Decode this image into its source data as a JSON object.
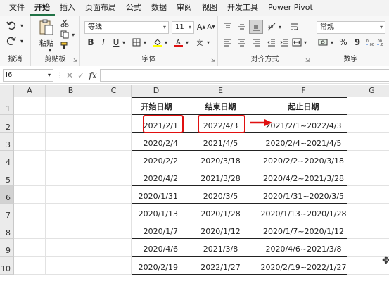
{
  "menu": {
    "items": [
      "文件",
      "开始",
      "插入",
      "页面布局",
      "公式",
      "数据",
      "审阅",
      "视图",
      "开发工具",
      "Power Pivot"
    ],
    "active_index": 1
  },
  "ribbon": {
    "undo_group_label": "撤消",
    "clipboard": {
      "paste_label": "粘贴",
      "group_label": "剪贴板"
    },
    "font": {
      "font_name": "等线",
      "font_size": "11",
      "group_label": "字体",
      "bold": "B",
      "italic": "I",
      "underline": "U"
    },
    "alignment": {
      "group_label": "对齐方式"
    },
    "number": {
      "format": "常规",
      "group_label": "数字",
      "percent": "%",
      "comma": "9"
    }
  },
  "formula_bar": {
    "name_box": "I6",
    "fx": "fx",
    "cancel": "✕",
    "enter": "✓",
    "value": ""
  },
  "sheet": {
    "columns": [
      "A",
      "B",
      "C",
      "D",
      "E",
      "F",
      "G"
    ],
    "selected_column": "I",
    "rows": [
      "1",
      "2",
      "3",
      "4",
      "5",
      "6",
      "7",
      "8",
      "9",
      "10"
    ],
    "selected_row": "6",
    "header": {
      "start": "开始日期",
      "end": "结束日期",
      "range": "起止日期"
    },
    "data": [
      {
        "start": "2021/2/1",
        "end": "2022/4/3",
        "range": "2021/2/1~2022/4/3"
      },
      {
        "start": "2020/2/4",
        "end": "2021/4/5",
        "range": "2020/2/4~2021/4/5"
      },
      {
        "start": "2020/2/2",
        "end": "2020/3/18",
        "range": "2020/2/2~2020/3/18"
      },
      {
        "start": "2020/4/2",
        "end": "2021/3/28",
        "range": "2020/4/2~2021/3/28"
      },
      {
        "start": "2020/1/31",
        "end": "2020/3/5",
        "range": "2020/1/31~2020/3/5"
      },
      {
        "start": "2020/1/13",
        "end": "2020/1/28",
        "range": "2020/1/13~2020/1/28"
      },
      {
        "start": "2020/1/7",
        "end": "2020/1/12",
        "range": "2020/1/7~2020/1/12"
      },
      {
        "start": "2020/4/6",
        "end": "2021/3/8",
        "range": "2020/4/6~2021/3/8"
      },
      {
        "start": "2020/2/19",
        "end": "2022/1/27",
        "range": "2020/2/19~2022/1/27"
      }
    ]
  },
  "annotation_color": "#e01010"
}
